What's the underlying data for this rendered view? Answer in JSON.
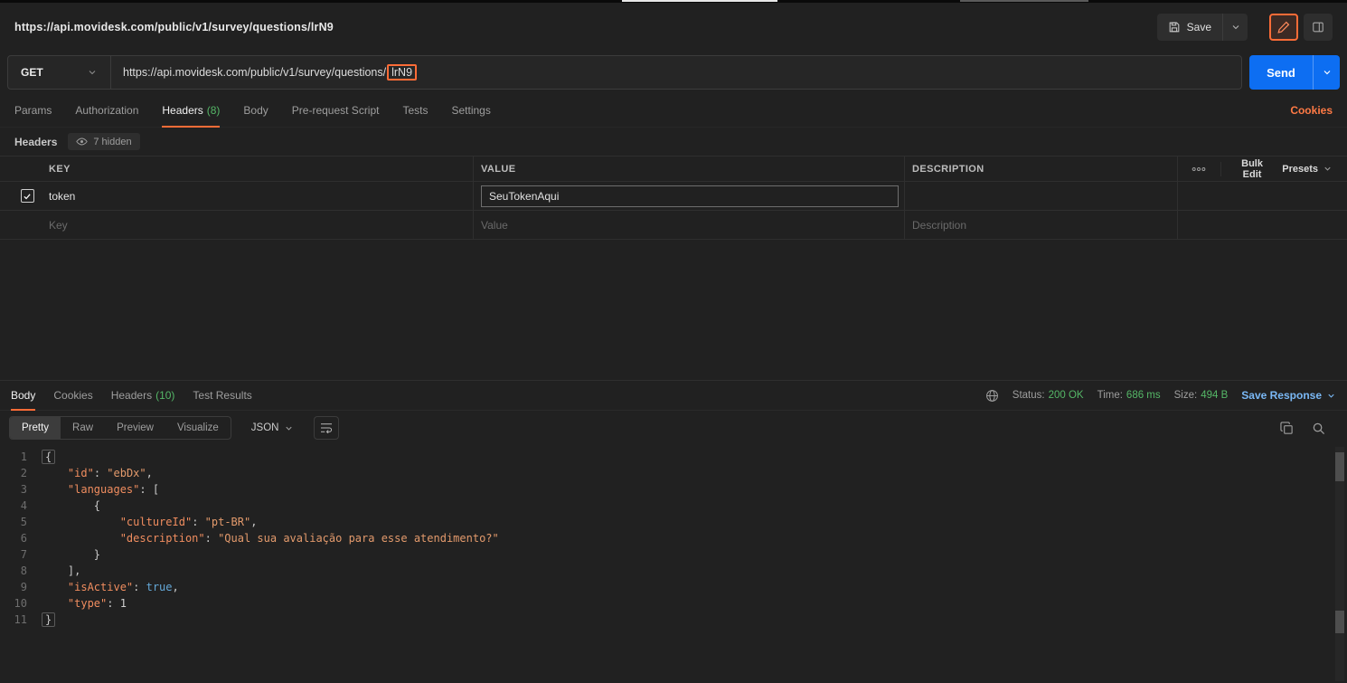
{
  "titlebar": {
    "title": "https://api.movidesk.com/public/v1/survey/questions/lrN9",
    "save_label": "Save"
  },
  "request": {
    "method": "GET",
    "url_prefix": "https://api.movidesk.com/public/v1/survey/questions/",
    "url_highlight": "lrN9",
    "send_label": "Send"
  },
  "request_tabs": {
    "params": "Params",
    "authorization": "Authorization",
    "headers": "Headers",
    "headers_count": "(8)",
    "body": "Body",
    "prerequest": "Pre-request Script",
    "tests": "Tests",
    "settings": "Settings",
    "cookies_link": "Cookies"
  },
  "headers_section": {
    "title": "Headers",
    "hidden_badge": "7 hidden",
    "columns": {
      "key": "KEY",
      "value": "VALUE",
      "description": "DESCRIPTION"
    },
    "bulk_edit": "Bulk Edit",
    "presets": "Presets",
    "row": {
      "key": "token",
      "value": "SeuTokenAqui",
      "description": ""
    },
    "placeholder": {
      "key": "Key",
      "value": "Value",
      "description": "Description"
    }
  },
  "response": {
    "tabs": {
      "body": "Body",
      "cookies": "Cookies",
      "headers": "Headers",
      "headers_count": "(10)",
      "test_results": "Test Results"
    },
    "meta": {
      "status_label": "Status:",
      "status_value": "200 OK",
      "time_label": "Time:",
      "time_value": "686 ms",
      "size_label": "Size:",
      "size_value": "494 B",
      "save_response": "Save Response"
    },
    "toolbar": {
      "pretty": "Pretty",
      "raw": "Raw",
      "preview": "Preview",
      "visualize": "Visualize",
      "format": "JSON"
    }
  },
  "colors": {
    "accent_orange": "#ff6c37",
    "send_blue": "#0d6ef2",
    "count_green": "#55b767",
    "link_blue": "#7ab8f5"
  },
  "code": {
    "lines": [
      {
        "n": "1",
        "fold": true,
        "tokens": [
          [
            "p",
            "{"
          ]
        ]
      },
      {
        "n": "2",
        "tokens": [
          [
            "w",
            "    "
          ],
          [
            "k",
            "\"id\""
          ],
          [
            "p",
            ": "
          ],
          [
            "s",
            "\"ebDx\""
          ],
          [
            "p",
            ","
          ]
        ]
      },
      {
        "n": "3",
        "tokens": [
          [
            "w",
            "    "
          ],
          [
            "k",
            "\"languages\""
          ],
          [
            "p",
            ": ["
          ]
        ]
      },
      {
        "n": "4",
        "tokens": [
          [
            "w",
            "        "
          ],
          [
            "p",
            "{"
          ]
        ]
      },
      {
        "n": "5",
        "tokens": [
          [
            "w",
            "            "
          ],
          [
            "k",
            "\"cultureId\""
          ],
          [
            "p",
            ": "
          ],
          [
            "s",
            "\"pt-BR\""
          ],
          [
            "p",
            ","
          ]
        ]
      },
      {
        "n": "6",
        "tokens": [
          [
            "w",
            "            "
          ],
          [
            "k",
            "\"description\""
          ],
          [
            "p",
            ": "
          ],
          [
            "s",
            "\"Qual sua avaliação para esse atendimento?\""
          ]
        ]
      },
      {
        "n": "7",
        "tokens": [
          [
            "w",
            "        "
          ],
          [
            "p",
            "}"
          ]
        ]
      },
      {
        "n": "8",
        "tokens": [
          [
            "w",
            "    "
          ],
          [
            "p",
            "],"
          ]
        ]
      },
      {
        "n": "9",
        "tokens": [
          [
            "w",
            "    "
          ],
          [
            "k",
            "\"isActive\""
          ],
          [
            "p",
            ": "
          ],
          [
            "b",
            "true"
          ],
          [
            "p",
            ","
          ]
        ]
      },
      {
        "n": "10",
        "tokens": [
          [
            "w",
            "    "
          ],
          [
            "k",
            "\"type\""
          ],
          [
            "p",
            ": "
          ],
          [
            "n",
            "1"
          ]
        ]
      },
      {
        "n": "11",
        "fold": true,
        "tokens": [
          [
            "p",
            "}"
          ]
        ]
      }
    ]
  }
}
